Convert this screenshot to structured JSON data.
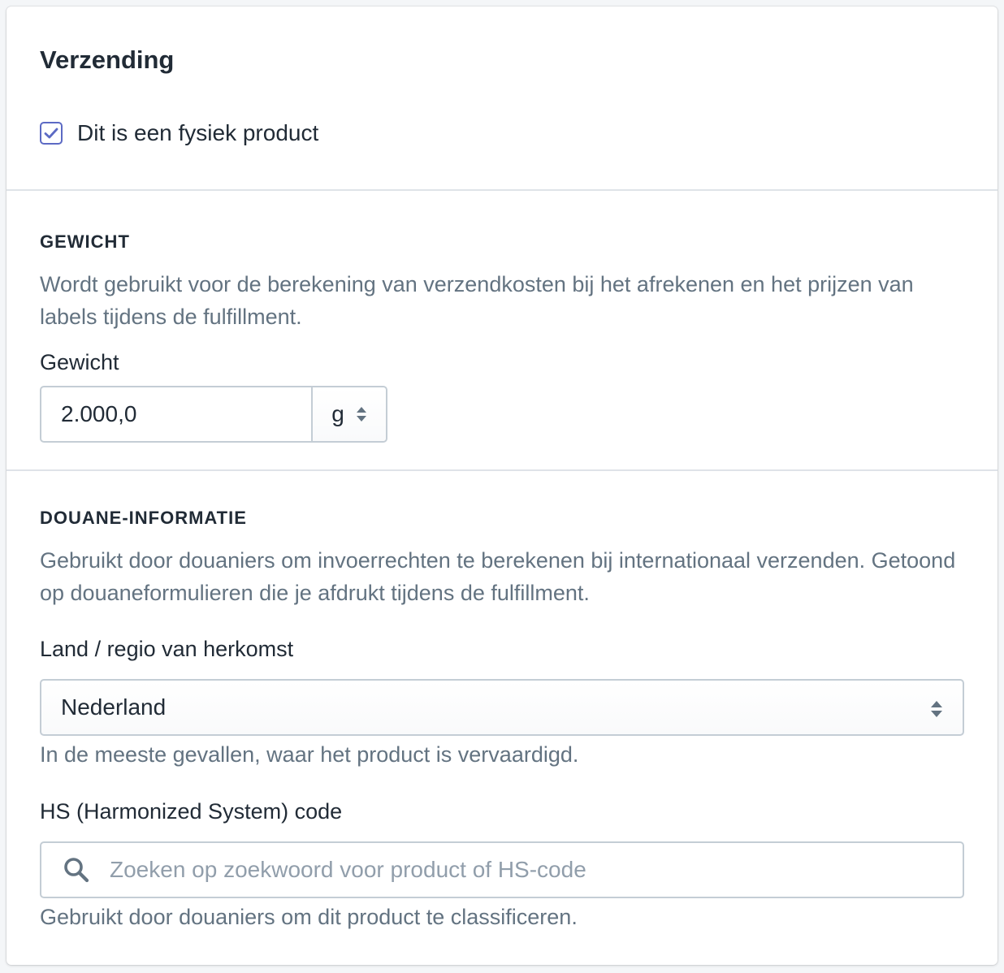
{
  "card": {
    "title": "Verzending",
    "physical_product": {
      "label": "Dit is een fysiek product",
      "checked": true
    }
  },
  "weight": {
    "heading": "GEWICHT",
    "description": "Wordt gebruikt voor de berekening van verzendkosten bij het afrekenen en het prijzen van labels tijdens de fulfillment.",
    "field_label": "Gewicht",
    "value": "2.000,0",
    "unit": "g"
  },
  "customs": {
    "heading": "DOUANE-INFORMATIE",
    "description": "Gebruikt door douaniers om invoerrechten te berekenen bij internationaal verzenden. Getoond op douaneformulieren die je afdrukt tijdens de fulfillment.",
    "country_label": "Land / regio van herkomst",
    "country_value": "Nederland",
    "country_help": "In de meeste gevallen, waar het product is vervaardigd.",
    "hs_label": "HS (Harmonized System) code",
    "hs_placeholder": "Zoeken op zoekwoord voor product of HS-code",
    "hs_help": "Gebruikt door douaniers om dit product te classificeren."
  },
  "colors": {
    "accent": "#5c6ac4",
    "text": "#212b36",
    "subdued": "#637381",
    "border": "#c4cdd5"
  },
  "icons": [
    "checkmark-icon",
    "select-arrows-icon",
    "search-icon"
  ]
}
